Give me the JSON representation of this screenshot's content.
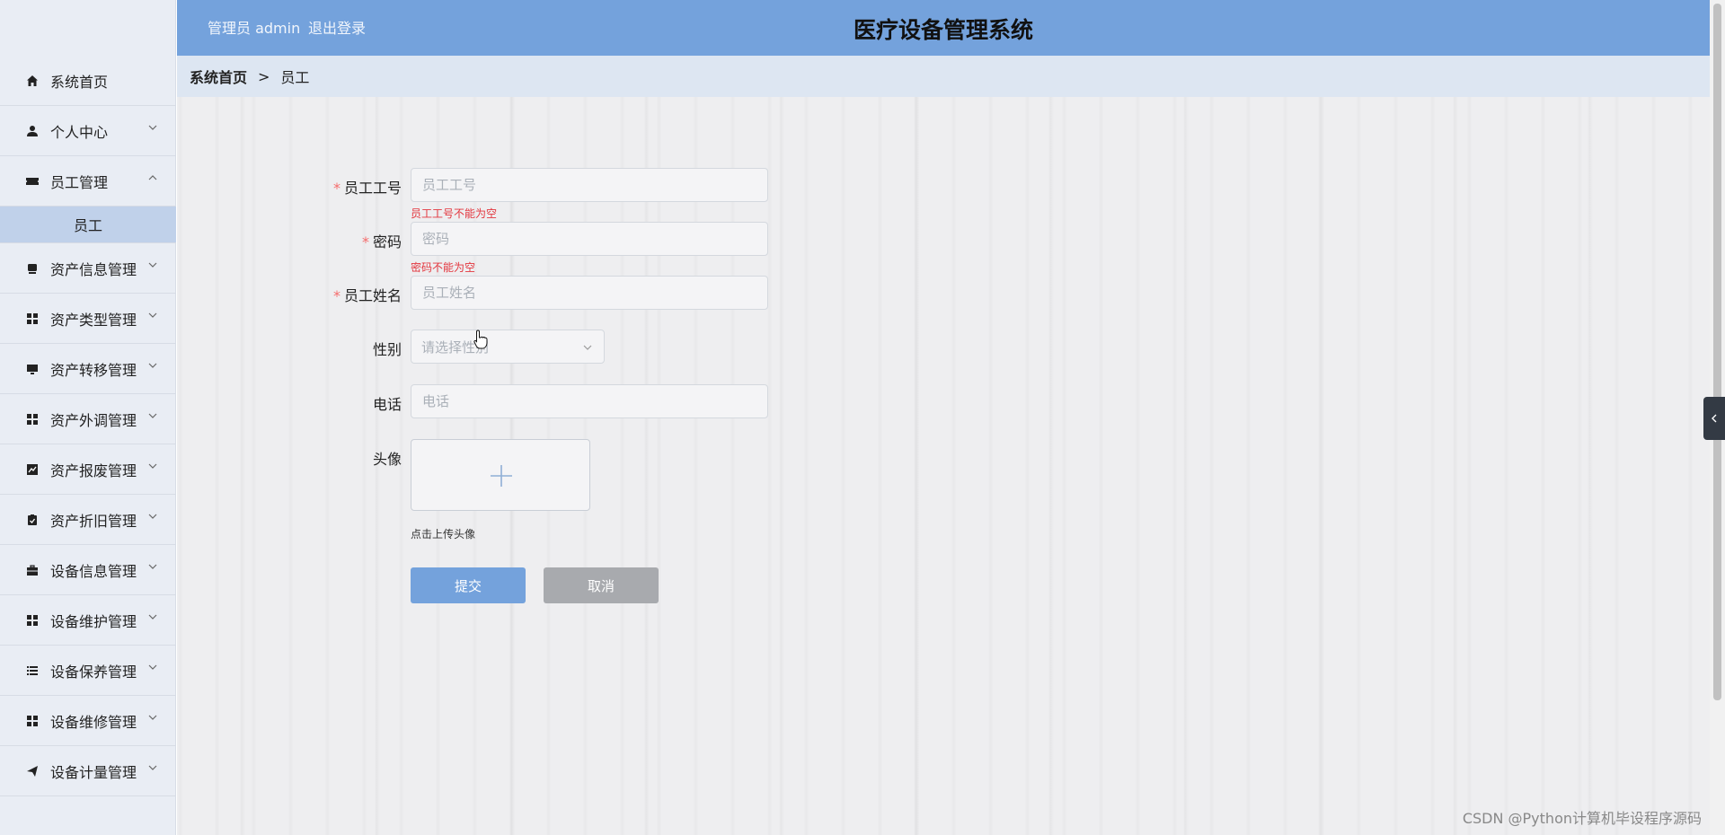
{
  "header": {
    "user_label": "管理员 admin",
    "logout_label": "退出登录",
    "title": "医疗设备管理系统"
  },
  "breadcrumb": {
    "home": "系统首页",
    "separator": ">",
    "current": "员工"
  },
  "sidebar": {
    "items": [
      {
        "label": "系统首页",
        "icon": "home-icon"
      },
      {
        "label": "个人中心",
        "icon": "user-icon"
      },
      {
        "label": "员工管理",
        "icon": "ticket-icon",
        "expanded": true
      },
      {
        "label": "资产信息管理",
        "icon": "storage-icon"
      },
      {
        "label": "资产类型管理",
        "icon": "grid-icon"
      },
      {
        "label": "资产转移管理",
        "icon": "monitor-icon"
      },
      {
        "label": "资产外调管理",
        "icon": "grid-icon"
      },
      {
        "label": "资产报废管理",
        "icon": "chart-icon"
      },
      {
        "label": "资产折旧管理",
        "icon": "clipboard-icon"
      },
      {
        "label": "设备信息管理",
        "icon": "briefcase-icon"
      },
      {
        "label": "设备维护管理",
        "icon": "grid-icon"
      },
      {
        "label": "设备保养管理",
        "icon": "list-icon"
      },
      {
        "label": "设备维修管理",
        "icon": "grid-icon"
      },
      {
        "label": "设备计量管理",
        "icon": "send-icon"
      }
    ],
    "submenu": {
      "label": "员工"
    }
  },
  "form": {
    "employee_id": {
      "label": "员工工号",
      "placeholder": "员工工号",
      "value": "",
      "error": "员工工号不能为空"
    },
    "password": {
      "label": "密码",
      "placeholder": "密码",
      "value": "",
      "error": "密码不能为空"
    },
    "name": {
      "label": "员工姓名",
      "placeholder": "员工姓名",
      "value": ""
    },
    "gender": {
      "label": "性别",
      "placeholder": "请选择性别"
    },
    "phone": {
      "label": "电话",
      "placeholder": "电话",
      "value": ""
    },
    "avatar": {
      "label": "头像",
      "hint": "点击上传头像"
    },
    "required_mark": "*",
    "submit_label": "提交",
    "cancel_label": "取消"
  },
  "watermark": "CSDN @Python计算机毕设程序源码",
  "colors": {
    "header": "#74a2dc",
    "sidebar": "#e9edf4",
    "submenu_active": "#c0d1ea",
    "error": "#e3363e",
    "cancel": "#a8aaae"
  }
}
